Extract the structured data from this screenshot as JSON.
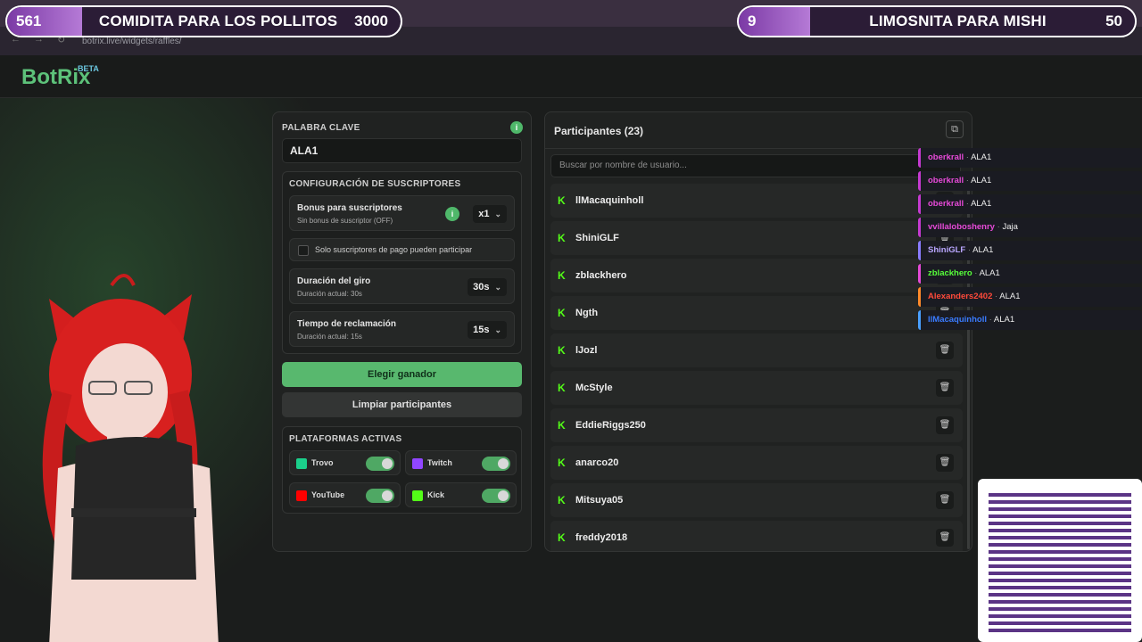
{
  "topbars": {
    "left": {
      "count": "561",
      "title": "COMIDITA PARA LOS POLLITOS",
      "goal": "3000"
    },
    "right": {
      "count": "9",
      "title": "LIMOSNITA PARA MISHI",
      "goal": "50"
    }
  },
  "browser": {
    "url": "botrix.live/widgets/raffles/"
  },
  "app": {
    "logo": "BotRix",
    "badge": "BETA"
  },
  "left_panel": {
    "keyword_label": "PALABRA CLAVE",
    "keyword_value": "ALA1",
    "subs_section": "CONFIGURACIÓN DE SUSCRIPTORES",
    "bonus_title": "Bonus para suscriptores",
    "bonus_sub": "Sin bonus de suscriptor (OFF)",
    "bonus_value": "x1",
    "paid_only": "Solo suscriptores de pago pueden participar",
    "spin_title": "Duración del giro",
    "spin_sub": "Duración actual: 30s",
    "spin_value": "30s",
    "claim_title": "Tiempo de reclamación",
    "claim_sub": "Duración actual: 15s",
    "claim_value": "15s",
    "pick_winner": "Elegir ganador",
    "clear_participants": "Limpiar participantes",
    "platforms_section": "PLATAFORMAS ACTIVAS",
    "platforms": [
      {
        "name": "Trovo",
        "color": "#1bcf8b"
      },
      {
        "name": "Twitch",
        "color": "#9146ff"
      },
      {
        "name": "YouTube",
        "color": "#ff0000"
      },
      {
        "name": "Kick",
        "color": "#53fc18"
      }
    ]
  },
  "right_panel": {
    "title": "Participantes (23)",
    "search_placeholder": "Buscar por nombre de usuario...",
    "participants": [
      "llMacaquinholl",
      "ShiniGLF",
      "zblackhero",
      "Ngth",
      "lJozl",
      "McStyle",
      "EddieRiggs250",
      "anarco20",
      "Mitsuya05",
      "freddy2018"
    ]
  },
  "chat": [
    {
      "user": "oberkrall",
      "msg": "ALA1",
      "color": "#e64ad8",
      "bar": "#c63ad1"
    },
    {
      "user": "oberkrall",
      "msg": "ALA1",
      "color": "#e64ad8",
      "bar": "#c63ad1"
    },
    {
      "user": "oberkrall",
      "msg": "ALA1",
      "color": "#e64ad8",
      "bar": "#c63ad1"
    },
    {
      "user": "vvillaloboshenry",
      "msg": "Jaja",
      "color": "#e64ad8",
      "bar": "#c63ad1"
    },
    {
      "user": "ShiniGLF",
      "msg": "ALA1",
      "color": "#b9a6ff",
      "bar": "#8a7cff"
    },
    {
      "user": "zblackhero",
      "msg": "ALA1",
      "color": "#57ff3a",
      "bar": "#e64ad8"
    },
    {
      "user": "Alexanders2402",
      "msg": "ALA1",
      "color": "#ff4a3a",
      "bar": "#ff8a2a"
    },
    {
      "user": "llMacaquinholl",
      "msg": "ALA1",
      "color": "#3a7bff",
      "bar": "#4aa0ff"
    }
  ]
}
